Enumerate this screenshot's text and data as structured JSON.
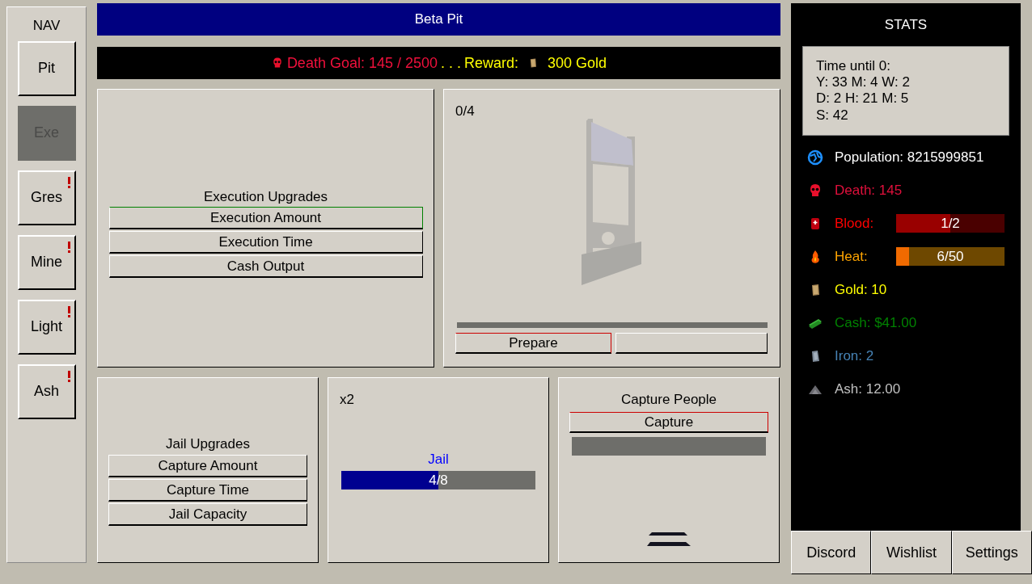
{
  "nav": {
    "title": "NAV",
    "items": [
      {
        "label": "Pit",
        "selected": false,
        "alert": false
      },
      {
        "label": "Exe",
        "selected": true,
        "alert": false
      },
      {
        "label": "Gres",
        "selected": false,
        "alert": true
      },
      {
        "label": "Mine",
        "selected": false,
        "alert": true
      },
      {
        "label": "Light",
        "selected": false,
        "alert": true
      },
      {
        "label": "Ash",
        "selected": false,
        "alert": true
      }
    ]
  },
  "header": {
    "title": "Beta Pit"
  },
  "goal_bar": {
    "goal": "Death Goal: 145 / 2500",
    "separator": ". . .",
    "reward_label": "Reward:",
    "reward_value": "300 Gold"
  },
  "execution_upgrades": {
    "title": "Execution Upgrades",
    "buttons": [
      {
        "label": "Execution Amount",
        "color": "#008000"
      },
      {
        "label": "Execution Time"
      },
      {
        "label": "Cash Output"
      }
    ]
  },
  "execution": {
    "counter": "0/4",
    "level": 0,
    "buttons": [
      {
        "label": "Prepare",
        "color": "#cc0000"
      }
    ]
  },
  "jail_upgrades": {
    "title": "Jail Upgrades",
    "buttons": [
      {
        "label": "Capture Amount"
      },
      {
        "label": "Capture Time"
      },
      {
        "label": "Jail Capacity"
      }
    ]
  },
  "jail": {
    "multiplier": "x2",
    "title": "Jail",
    "reading": "4/8",
    "level": 0.5
  },
  "capture": {
    "title": "Capture People",
    "button": {
      "label": "Capture",
      "color": "#cc0000"
    },
    "level": 0
  },
  "stats": {
    "title": "STATS",
    "timer": [
      "Time until 0:",
      "Y: 33 M: 4 W: 2",
      "D: 2 H: 21 M: 5",
      "S: 42"
    ],
    "rows": [
      {
        "kind": "text",
        "label": "Population: 8215999851",
        "color": "#ffffff"
      },
      {
        "kind": "text",
        "label": "Death: 145",
        "color": "#e0103c"
      },
      {
        "kind": "bar",
        "label": "Blood:",
        "color": "#ff0000",
        "reading": "1/2",
        "level": 0.5
      },
      {
        "kind": "bar",
        "label": "Heat:",
        "color": "#ffa500",
        "reading": "6/50",
        "level": 0.12
      },
      {
        "kind": "text",
        "label": "Gold: 10",
        "color": "#ffff00"
      },
      {
        "kind": "text",
        "label": "Cash: $41.00",
        "color": "#008000"
      },
      {
        "kind": "text",
        "label": "Iron: 2",
        "color": "#4682b4"
      },
      {
        "kind": "text",
        "label": "Ash: 12.00",
        "color": "#c0c0c0"
      }
    ]
  },
  "footer": {
    "buttons": [
      "Discord",
      "Wishlist",
      "Settings"
    ]
  }
}
